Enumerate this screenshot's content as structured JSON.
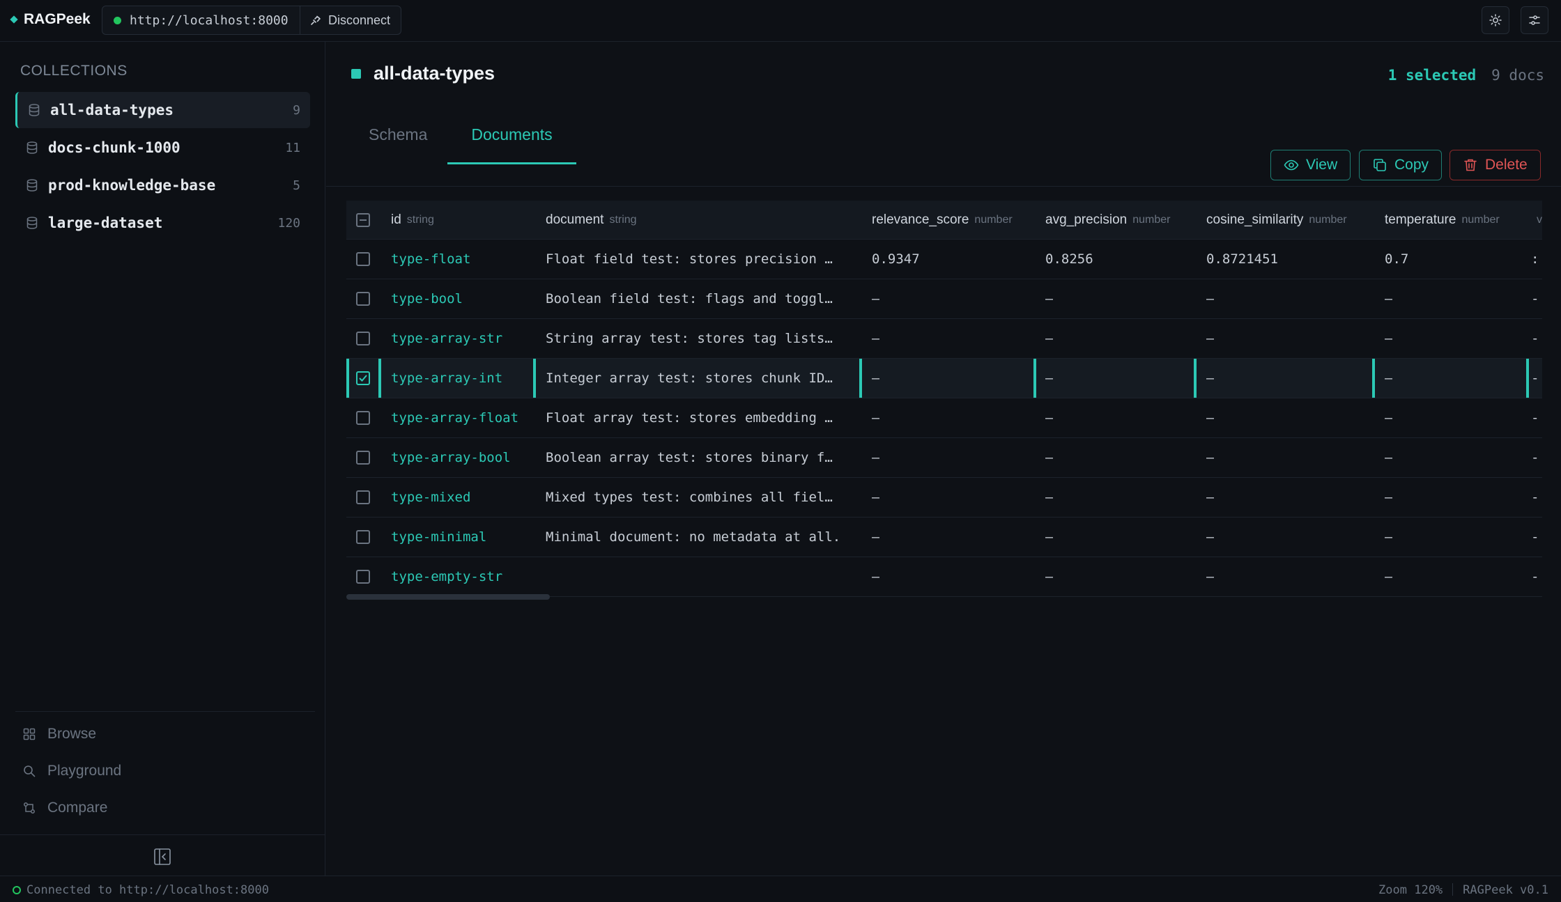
{
  "app": {
    "name": "RAGPeek"
  },
  "connection": {
    "url": "http://localhost:8000",
    "disconnect_label": "Disconnect"
  },
  "sidebar": {
    "heading": "COLLECTIONS",
    "collections": [
      {
        "name": "all-data-types",
        "count": "9",
        "active": true
      },
      {
        "name": "docs-chunk-1000",
        "count": "11"
      },
      {
        "name": "prod-knowledge-base",
        "count": "5"
      },
      {
        "name": "large-dataset",
        "count": "120"
      }
    ],
    "nav": [
      {
        "label": "Browse",
        "icon": "grid-icon"
      },
      {
        "label": "Playground",
        "icon": "search-icon"
      },
      {
        "label": "Compare",
        "icon": "compare-icon"
      }
    ]
  },
  "main": {
    "title": "all-data-types",
    "selected_label": "1 selected",
    "docs_label": "9 docs",
    "tabs": {
      "schema": "Schema",
      "documents": "Documents"
    },
    "actions": {
      "view": "View",
      "copy": "Copy",
      "delete": "Delete"
    }
  },
  "table": {
    "columns": [
      {
        "name": "id",
        "type": "string"
      },
      {
        "name": "document",
        "type": "string"
      },
      {
        "name": "relevance_score",
        "type": "number"
      },
      {
        "name": "avg_precision",
        "type": "number"
      },
      {
        "name": "cosine_similarity",
        "type": "number"
      },
      {
        "name": "temperature",
        "type": "number"
      }
    ],
    "rows": [
      {
        "id": "type-float",
        "document": "Float field test: stores precision …",
        "c1": "0.9347",
        "c2": "0.8256",
        "c3": "0.8721451",
        "c4": "0.7",
        "selected": false
      },
      {
        "id": "type-bool",
        "document": "Boolean field test: flags and toggl…",
        "c1": "–",
        "c2": "–",
        "c3": "–",
        "c4": "–",
        "selected": false
      },
      {
        "id": "type-array-str",
        "document": "String array test: stores tag lists…",
        "c1": "–",
        "c2": "–",
        "c3": "–",
        "c4": "–",
        "selected": false
      },
      {
        "id": "type-array-int",
        "document": "Integer array test: stores chunk ID…",
        "c1": "–",
        "c2": "–",
        "c3": "–",
        "c4": "–",
        "selected": true
      },
      {
        "id": "type-array-float",
        "document": "Float array test: stores embedding …",
        "c1": "–",
        "c2": "–",
        "c3": "–",
        "c4": "–",
        "selected": false
      },
      {
        "id": "type-array-bool",
        "document": "Boolean array test: stores binary f…",
        "c1": "–",
        "c2": "–",
        "c3": "–",
        "c4": "–",
        "selected": false
      },
      {
        "id": "type-mixed",
        "document": "Mixed types test: combines all fiel…",
        "c1": "–",
        "c2": "–",
        "c3": "–",
        "c4": "–",
        "selected": false
      },
      {
        "id": "type-minimal",
        "document": "Minimal document: no metadata at all.",
        "c1": "–",
        "c2": "–",
        "c3": "–",
        "c4": "–",
        "selected": false
      },
      {
        "id": "type-empty-str",
        "document": "",
        "c1": "–",
        "c2": "–",
        "c3": "–",
        "c4": "–",
        "selected": false
      }
    ]
  },
  "status": {
    "connected": "Connected to http://localhost:8000",
    "zoom": "Zoom 120%",
    "version": "RAGPeek v0.1"
  },
  "colors": {
    "accent": "#2cc9b5",
    "danger": "#e05555",
    "online": "#22c55e",
    "background": "#0e1116"
  }
}
